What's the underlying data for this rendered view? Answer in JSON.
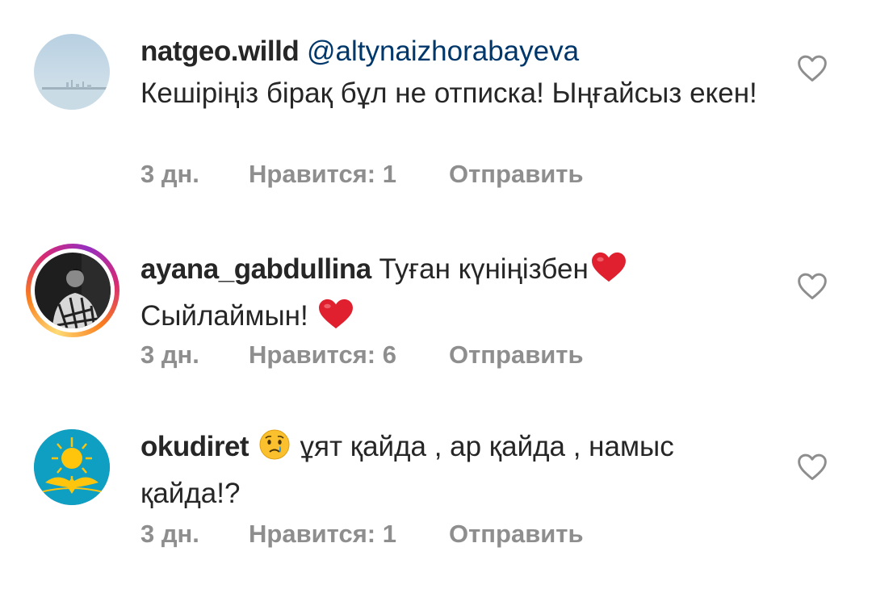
{
  "comments": [
    {
      "username": "natgeo.willd",
      "mention": "@altynaizhorabayeva",
      "text": "Кешіріңіз бірақ бұл не отписка! Ыңғайсыз екен!",
      "time": "3 дн.",
      "likes": "Нравится: 1",
      "reply": "Отправить",
      "avatar_icon": "city-skyline-avatar"
    },
    {
      "username": "ayana_gabdullina",
      "text_line1": "Туған күніңізбен",
      "text_line2": "Сыйлаймын!",
      "time": "3 дн.",
      "likes": "Нравится: 6",
      "reply": "Отправить",
      "avatar_icon": "person-photo-avatar",
      "has_story_ring": true
    },
    {
      "username": "okudiret",
      "text": "ұят қайда , ар қайда , намыс қайда!?",
      "time": "3 дн.",
      "likes": "Нравится: 1",
      "reply": "Отправить",
      "avatar_icon": "kazakhstan-flag-avatar"
    }
  ],
  "colors": {
    "text": "#262626",
    "mention": "#00376b",
    "meta": "#8e8e8e",
    "heart_outline": "#8e8e8e",
    "heart_emoji": "#e0202f",
    "flag_blue": "#00afca",
    "flag_gold": "#fec50c"
  },
  "icons": [
    "heart-outline-icon",
    "red-heart-emoji",
    "crying-face-emoji"
  ]
}
